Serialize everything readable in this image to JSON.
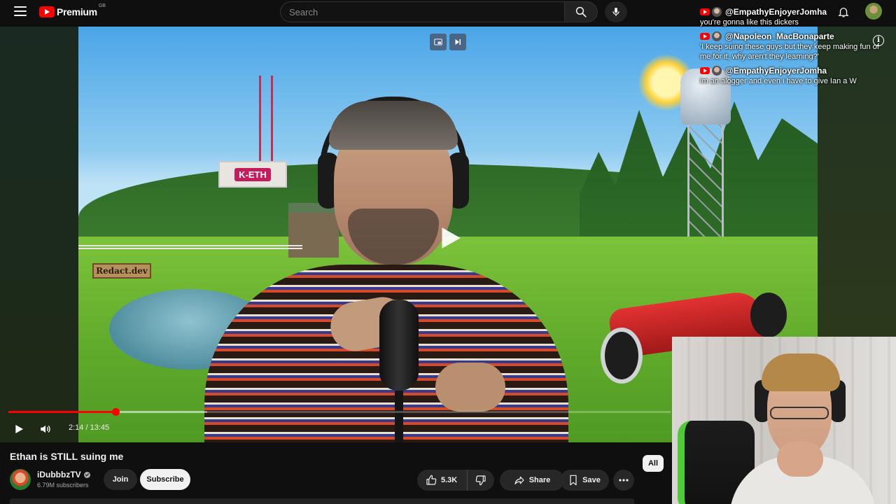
{
  "app": {
    "logo_text": "Premium",
    "region": "GB"
  },
  "search": {
    "placeholder": "Search",
    "value": ""
  },
  "player": {
    "current_time": "2:14",
    "duration": "13:45",
    "time_readout": "2:14 / 13:45",
    "progress_fraction": 0.162,
    "loaded_fraction": 0.3,
    "scene_labels": {
      "radio_sign": "K-ETH",
      "field_sign": "Redact.dev"
    }
  },
  "chat": {
    "messages": [
      {
        "user": "@EmpathyEnjoyerJomha",
        "text": "you're gonna like this dickers"
      },
      {
        "user": "@Napoleon_MacBonaparte",
        "text": "'I keep suing these guys but they keep making fun of me for it, why aren't they learning?'"
      },
      {
        "user": "@EmpathyEnjoyerJomha",
        "text": "im an alogger and even i have to give Ian a W"
      }
    ]
  },
  "video": {
    "title": "Ethan is STILL suing me",
    "channel_name": "iDubbbzTV",
    "subscribers": "6.79M subscribers"
  },
  "actions": {
    "join_label": "Join",
    "subscribe_label": "Subscribe",
    "like_count": "5.3K",
    "share_label": "Share",
    "save_label": "Save"
  },
  "chips": {
    "all_label": "All"
  },
  "colors": {
    "brand_red": "#ff0000",
    "background": "#0f0f0f",
    "button_bg": "#272727"
  }
}
